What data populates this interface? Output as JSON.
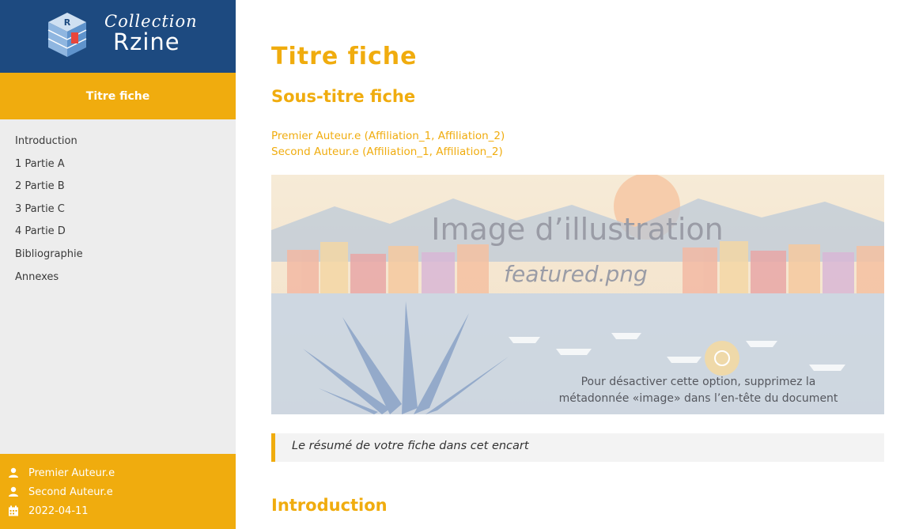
{
  "sidebar": {
    "logo": {
      "small": "Collection",
      "big": "Rzine",
      "badge_letter": "R"
    },
    "title": "Titre fiche",
    "nav": [
      "Introduction",
      "1 Partie A",
      "2 Partie B",
      "3 Partie C",
      "4 Partie D",
      "Bibliographie",
      "Annexes"
    ],
    "meta": {
      "author1": "Premier Auteur.e",
      "author2": "Second Auteur.e",
      "date": "2022-04-11",
      "author_icon": "user-icon",
      "date_icon": "calendar-icon"
    }
  },
  "main": {
    "title": "Titre fiche",
    "subtitle": "Sous-titre fiche",
    "authors": [
      "Premier Auteur.e (Affiliation_1, Affiliation_2)",
      "Second Auteur.e (Affiliation_1, Affiliation_2)"
    ],
    "banner": {
      "heading": "Image d’illustration",
      "filename": "featured.png",
      "note_line1": "Pour désactiver cette option,  supprimez la",
      "note_line2": "métadonnée «image» dans l’en-tête du document"
    },
    "abstract": "Le résumé de votre fiche dans cet encart",
    "section_intro": "Introduction"
  },
  "colors": {
    "navy": "#1d4a80",
    "accent": "#f0ac0e",
    "sidebar_bg": "#ededed"
  }
}
